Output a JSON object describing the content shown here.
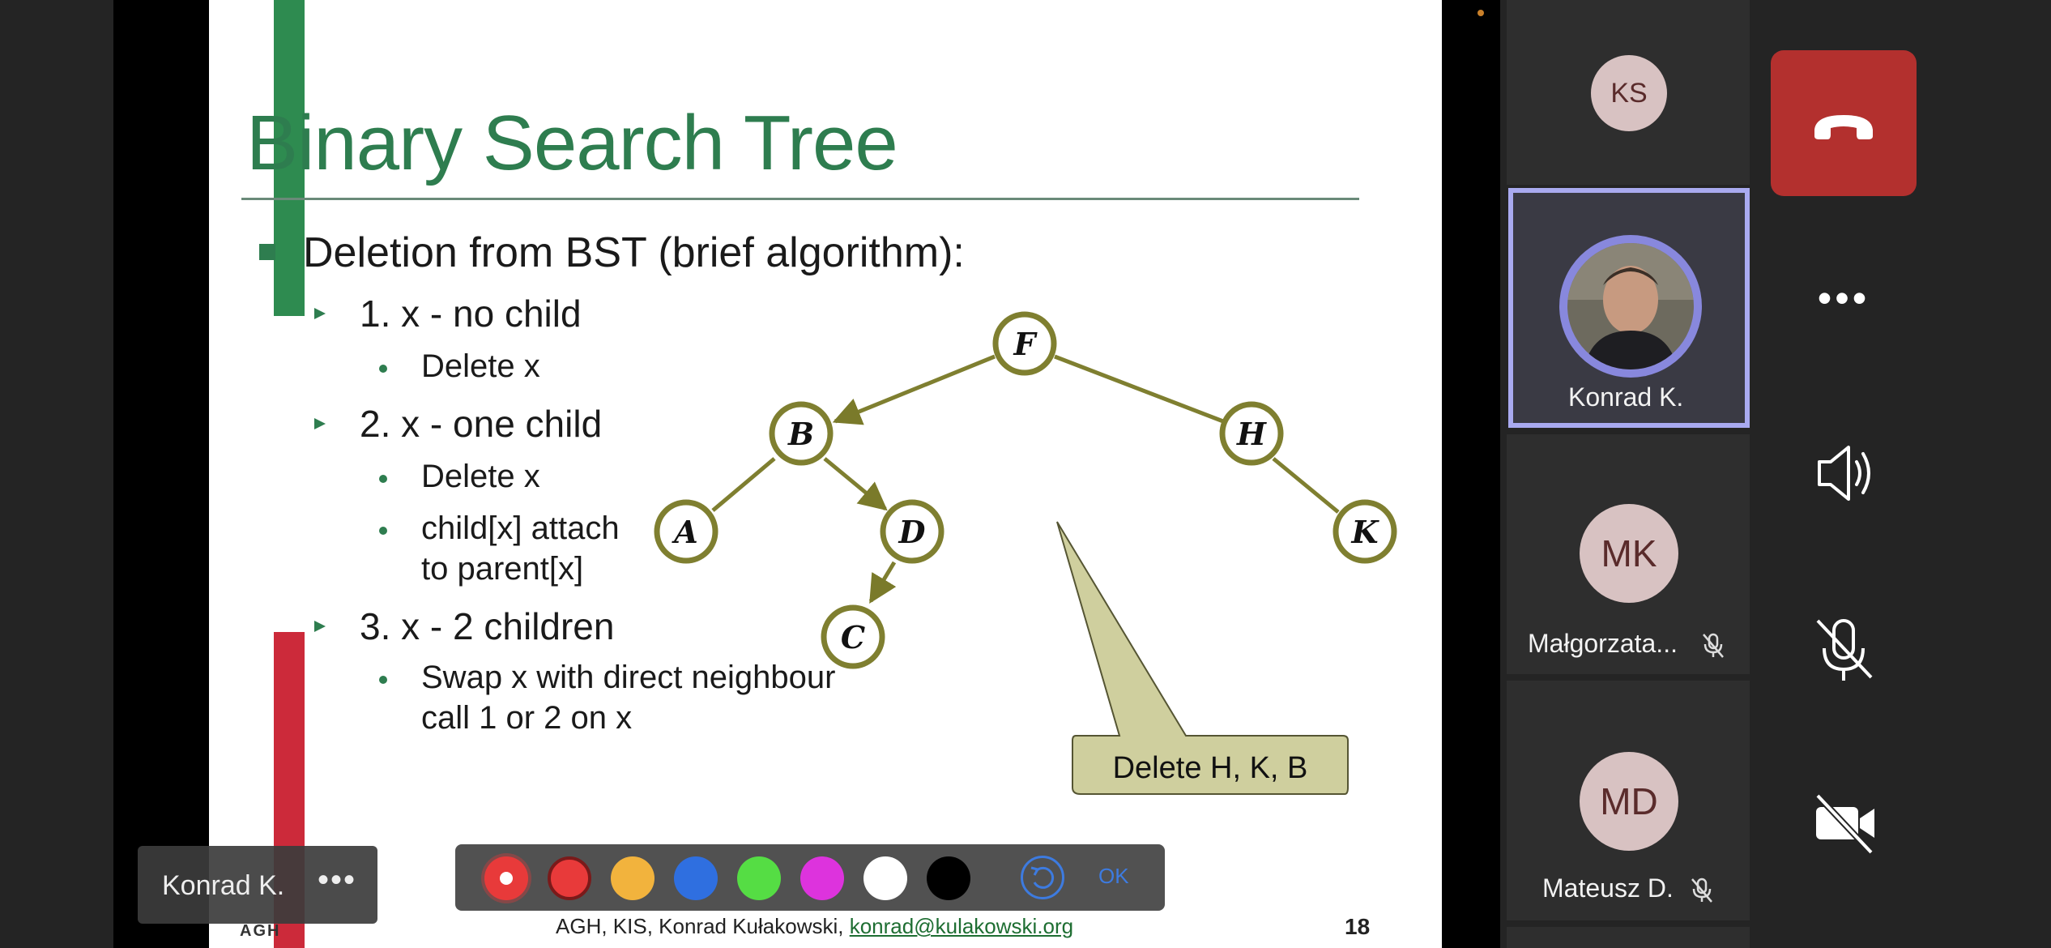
{
  "slide": {
    "title": "Binary Search Tree",
    "bullet_main": "Deletion from BST (brief algorithm):",
    "step1": "1. x - no child",
    "step1_sub": "Delete x",
    "step2": "2. x - one child",
    "step2_sub1": "Delete x",
    "step2_sub2_line1": "child[x] attach",
    "step2_sub2_line2": "to parent[x]",
    "step3": "3. x - 2 children",
    "step3_sub_line1": "Swap x with direct neighbour",
    "step3_sub_line2": "call 1 or 2 on x",
    "callout": "Delete H, K, B",
    "footer_logo": "AGH",
    "footer_text": "AGH, KIS, Konrad Kułakowski,",
    "footer_link": "konrad@kulakowski.org",
    "page_number": "18",
    "tree_nodes": {
      "F": "F",
      "B": "B",
      "H": "H",
      "A": "A",
      "D": "D",
      "K": "K",
      "C": "C"
    }
  },
  "presenter": {
    "name": "Konrad K.",
    "more": "•••"
  },
  "toolbar": {
    "ok_label": "OK",
    "colors": [
      "#e83a3a",
      "#f2b33d",
      "#2f6fe0",
      "#55dd44",
      "#dd33dd",
      "#ffffff",
      "#000000"
    ]
  },
  "participants": [
    {
      "initials": "KS",
      "name": ""
    },
    {
      "initials": "",
      "name": "Konrad K."
    },
    {
      "initials": "MK",
      "name": "Małgorzata..."
    },
    {
      "initials": "MD",
      "name": "Mateusz D."
    }
  ],
  "controls": {
    "more": "•••"
  }
}
